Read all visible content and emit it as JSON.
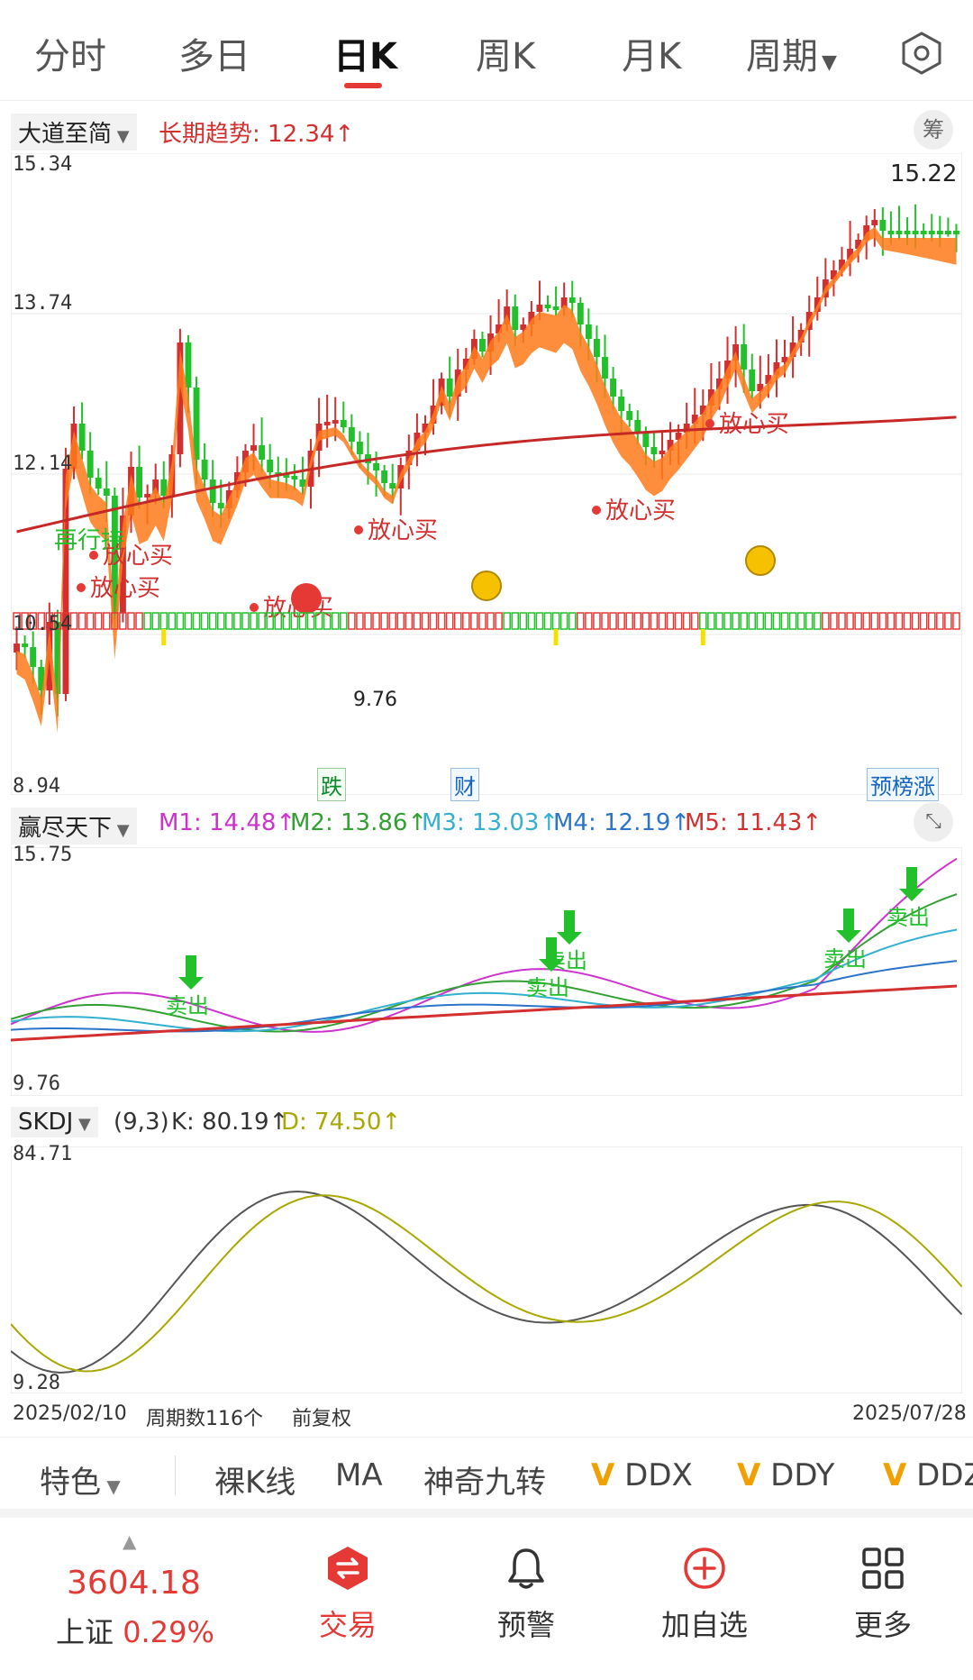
{
  "tabs": [
    {
      "label": "分时"
    },
    {
      "label": "多日"
    },
    {
      "label": "日K"
    },
    {
      "label": "周K"
    },
    {
      "label": "月K"
    },
    {
      "label": "周期"
    }
  ],
  "main_panel": {
    "indicator_name": "大道至简",
    "trend_text": "长期趋势: 12.34↑",
    "right_button": "筹",
    "y_ticks": [
      "15.34",
      "13.74",
      "12.14",
      "10.54",
      "8.94"
    ],
    "high_label": "15.22",
    "low_label": "9.76",
    "buy_signal": "放心买",
    "hold_signal": "再行持",
    "bottom_tags": [
      "跌",
      "财",
      "预榜涨"
    ]
  },
  "mid_panel": {
    "indicator_name": "赢尽天下",
    "values": [
      {
        "label": "M1: 14.48↑",
        "color": "#cc33cc"
      },
      {
        "label": "M2: 13.86↑",
        "color": "#33a033"
      },
      {
        "label": "M3: 13.03↑",
        "color": "#33b0d0"
      },
      {
        "label": "M4: 12.19↑",
        "color": "#2b74c9"
      },
      {
        "label": "M5: 11.43↑",
        "color": "#d32f2f"
      }
    ],
    "y_top": "15.75",
    "y_bottom": "9.76",
    "sell_signal": "卖出"
  },
  "low_panel": {
    "indicator_name": "SKDJ",
    "params": "(9,3)",
    "k_text": "K: 80.19↑",
    "d_text": "D: 74.50↑",
    "y_top": "84.71",
    "y_bottom": "9.28"
  },
  "footer_axis": {
    "start_date": "2025/02/10",
    "period_count": "周期数116个",
    "adjust": "前复权",
    "end_date": "2025/07/28"
  },
  "indicator_bar": {
    "special": "特色",
    "items": [
      "裸K线",
      "MA",
      "神奇九转",
      "DDX",
      "DDY",
      "DDZ"
    ]
  },
  "nav": {
    "index_value": "3604.18",
    "index_name": "上证",
    "index_pct": "0.29%",
    "items": [
      {
        "label": "交易",
        "icon": "trade-icon"
      },
      {
        "label": "预警",
        "icon": "bell-icon"
      },
      {
        "label": "加自选",
        "icon": "add-circle-icon"
      },
      {
        "label": "更多",
        "icon": "grid-icon"
      }
    ]
  },
  "colors": {
    "up": "#d32f2f",
    "down": "#22c02a",
    "ribbon": "#ff7a1a",
    "accent": "#e53935"
  }
}
